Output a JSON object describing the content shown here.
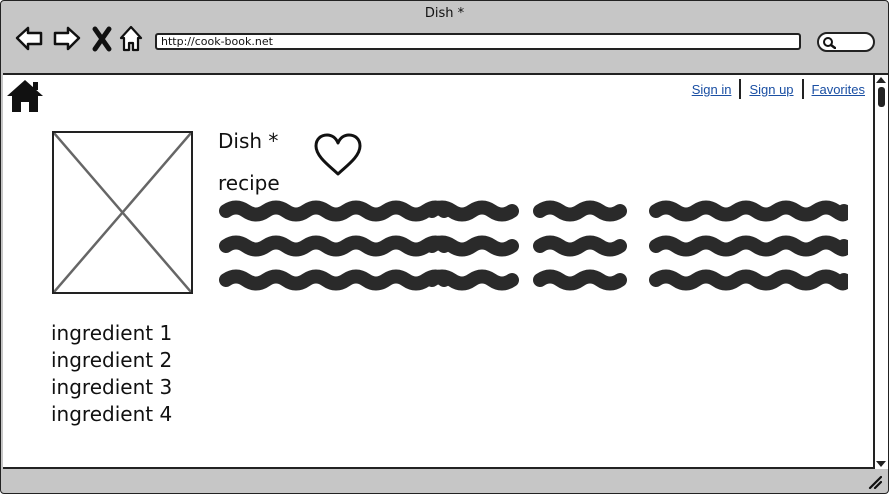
{
  "window": {
    "title": "Dish *"
  },
  "toolbar": {
    "url": "http://cook-book.net"
  },
  "header": {
    "links": {
      "sign_in": "Sign in",
      "sign_up": "Sign up",
      "favorites": "Favorites"
    }
  },
  "dish": {
    "title": "Dish *",
    "recipe_label": "recipe",
    "ingredients": [
      "ingredient 1",
      "ingredient 2",
      "ingredient 3",
      "ingredient 4"
    ]
  },
  "icons": [
    "back-arrow-icon",
    "forward-arrow-icon",
    "close-icon",
    "home-icon",
    "search-icon",
    "heart-icon",
    "image-placeholder-icon",
    "resize-grip-icon"
  ],
  "colors": {
    "link": "#1a4fa3",
    "chrome": "#c6c6c6",
    "ink": "#222222"
  }
}
